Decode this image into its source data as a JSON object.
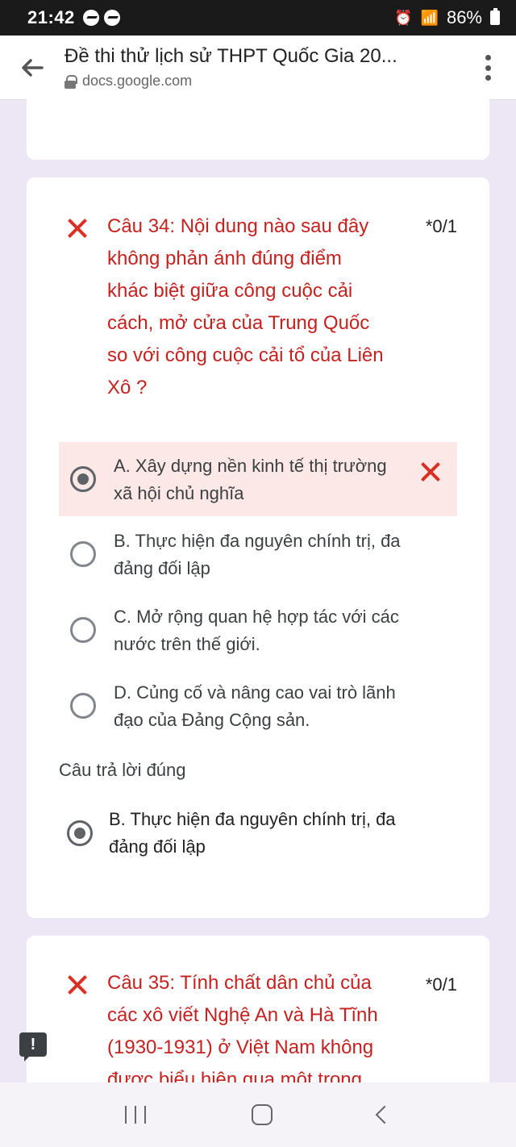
{
  "status_bar": {
    "time": "21:42",
    "battery": "86%"
  },
  "app_bar": {
    "title": "Đề thi thử lịch sử THPT Quốc Gia 20...",
    "url": "docs.google.com"
  },
  "question_34": {
    "text": "Câu 34: Nội dung nào sau đây không phản ánh đúng điểm khác biệt giữa công cuộc cải cách, mở cửa của Trung Quốc so với công cuộc cải tổ của Liên Xô ?",
    "lines": [
      "Câu 34: Nội dung nào sau đây",
      "không phản ánh đúng điểm",
      "khác biệt giữa công cuộc cải",
      "cách, mở cửa của Trung Quốc",
      "so với công cuộc cải tổ của Liên",
      "Xô ?"
    ],
    "score": "*0/1",
    "options": [
      {
        "lines": [
          "A. Xây dựng nền kinh tế thị trường",
          "xã hội chủ nghĩa"
        ],
        "selected": true,
        "wrong": true
      },
      {
        "lines": [
          "B. Thực hiện đa nguyên chính trị, đa",
          "đảng đối lập"
        ],
        "selected": false
      },
      {
        "lines": [
          "C. Mở rộng quan hệ hợp tác với các",
          "nước trên thế giới."
        ],
        "selected": false
      },
      {
        "lines": [
          "D. Củng cố và nâng cao vai trò lãnh",
          "đạo của Đảng Cộng sản."
        ],
        "selected": false
      }
    ],
    "correct_heading": "Câu trả lời đúng",
    "correct_answer": {
      "lines": [
        "B. Thực hiện đa nguyên chính trị, đa",
        "đảng đối lập"
      ]
    }
  },
  "question_35": {
    "lines": [
      "Câu 35: Tính chất dân chủ của",
      "các xô viết Nghệ An và Hà Tĩnh",
      "(1930-1931) ở Việt Nam không",
      "được biểu hiện qua một trong"
    ],
    "score": "*0/1"
  },
  "feedback_icon_text": "!",
  "icons": {
    "back": "arrow-left-icon",
    "lock": "lock-icon",
    "menu": "more-vert-icon",
    "wrong": "close-icon",
    "feedback": "feedback-icon"
  }
}
